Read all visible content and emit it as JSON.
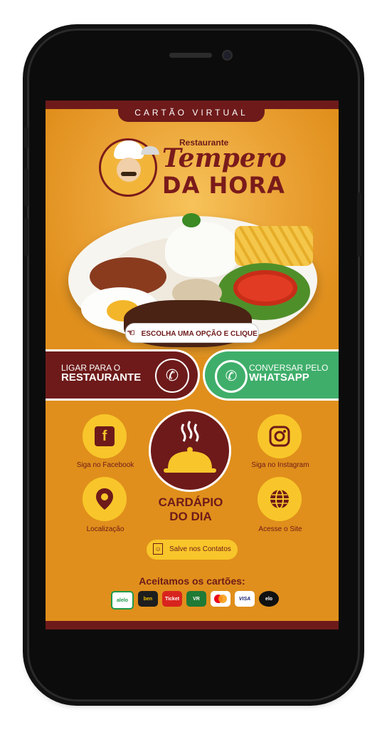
{
  "header": {
    "tab_label": "CARTÃO VIRTUAL",
    "logo_small": "Restaurante",
    "logo_main": "Tempero",
    "logo_sub": "DA HORA"
  },
  "hero": {
    "choose_prompt": "ESCOLHA UMA OPÇÃO E CLIQUE"
  },
  "actions": {
    "call_line1": "LIGAR PARA O",
    "call_line2": "RESTAURANTE",
    "wa_line1": "CONVERSAR PELO",
    "wa_line2": "WHATSAPP"
  },
  "links": {
    "facebook": "Siga no Facebook",
    "instagram": "Siga no Instagram",
    "location": "Localização",
    "site": "Acesse o Site",
    "menu_line1": "CARDÁPIO",
    "menu_line2": "DO DIA",
    "save": "Salve nos Contatos"
  },
  "payments": {
    "title": "Aceitamos os cartões:",
    "cards": [
      "alelo",
      "ben",
      "Ticket",
      "VR",
      "mastercard",
      "VISA",
      "elo"
    ]
  },
  "colors": {
    "brand_maroon": "#6e1a1a",
    "brand_orange": "#e08f1c",
    "brand_yellow": "#f8c62a",
    "whatsapp_green": "#3fae6a"
  }
}
